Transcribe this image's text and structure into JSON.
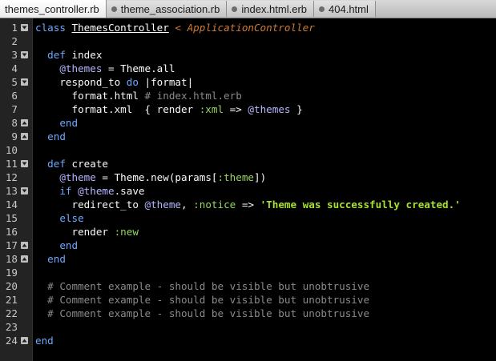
{
  "tabs": [
    {
      "label": "themes_controller.rb",
      "active": true
    },
    {
      "label": "theme_association.rb",
      "active": false
    },
    {
      "label": "index.html.erb",
      "active": false
    },
    {
      "label": "404.html",
      "active": false
    }
  ],
  "lines": [
    {
      "n": "1",
      "fold": "start",
      "tokens": [
        [
          "kw",
          "class "
        ],
        [
          "cls",
          "ThemesController"
        ],
        [
          "inh",
          " < ApplicationController"
        ]
      ]
    },
    {
      "n": "2",
      "fold": "",
      "tokens": []
    },
    {
      "n": "3",
      "fold": "start",
      "tokens": [
        [
          "plain",
          "  "
        ],
        [
          "kw",
          "def "
        ],
        [
          "plain",
          "index"
        ]
      ]
    },
    {
      "n": "4",
      "fold": "",
      "tokens": [
        [
          "plain",
          "    "
        ],
        [
          "ivar",
          "@themes"
        ],
        [
          "plain",
          " = "
        ],
        [
          "const",
          "Theme"
        ],
        [
          "plain",
          ".all"
        ]
      ]
    },
    {
      "n": "5",
      "fold": "start",
      "tokens": [
        [
          "plain",
          "    respond_to "
        ],
        [
          "kw",
          "do"
        ],
        [
          "plain",
          " |format|"
        ]
      ]
    },
    {
      "n": "6",
      "fold": "",
      "tokens": [
        [
          "plain",
          "      format.html "
        ],
        [
          "com",
          "# index.html.erb"
        ]
      ]
    },
    {
      "n": "7",
      "fold": "",
      "tokens": [
        [
          "plain",
          "      format.xml  { render "
        ],
        [
          "sym",
          ":xml"
        ],
        [
          "plain",
          " => "
        ],
        [
          "ivar",
          "@themes"
        ],
        [
          "plain",
          " }"
        ]
      ]
    },
    {
      "n": "8",
      "fold": "end",
      "tokens": [
        [
          "plain",
          "    "
        ],
        [
          "kw",
          "end"
        ]
      ]
    },
    {
      "n": "9",
      "fold": "end",
      "tokens": [
        [
          "plain",
          "  "
        ],
        [
          "kw",
          "end"
        ]
      ]
    },
    {
      "n": "10",
      "fold": "",
      "tokens": []
    },
    {
      "n": "11",
      "fold": "start",
      "tokens": [
        [
          "plain",
          "  "
        ],
        [
          "kw",
          "def "
        ],
        [
          "plain",
          "create"
        ]
      ]
    },
    {
      "n": "12",
      "fold": "",
      "tokens": [
        [
          "plain",
          "    "
        ],
        [
          "ivar",
          "@theme"
        ],
        [
          "plain",
          " = "
        ],
        [
          "const",
          "Theme"
        ],
        [
          "plain",
          ".new(params["
        ],
        [
          "sym",
          ":theme"
        ],
        [
          "plain",
          "])"
        ]
      ]
    },
    {
      "n": "13",
      "fold": "start",
      "tokens": [
        [
          "plain",
          "    "
        ],
        [
          "kw",
          "if "
        ],
        [
          "ivar",
          "@theme"
        ],
        [
          "plain",
          ".save"
        ]
      ]
    },
    {
      "n": "14",
      "fold": "",
      "tokens": [
        [
          "plain",
          "      redirect_to "
        ],
        [
          "ivar",
          "@theme"
        ],
        [
          "plain",
          ", "
        ],
        [
          "sym",
          ":notice"
        ],
        [
          "plain",
          " => "
        ],
        [
          "str",
          "'Theme was successfully created.'"
        ]
      ]
    },
    {
      "n": "15",
      "fold": "",
      "tokens": [
        [
          "plain",
          "    "
        ],
        [
          "kw",
          "else"
        ]
      ]
    },
    {
      "n": "16",
      "fold": "",
      "tokens": [
        [
          "plain",
          "      render "
        ],
        [
          "sym",
          ":new"
        ]
      ]
    },
    {
      "n": "17",
      "fold": "end",
      "tokens": [
        [
          "plain",
          "    "
        ],
        [
          "kw",
          "end"
        ]
      ]
    },
    {
      "n": "18",
      "fold": "end",
      "tokens": [
        [
          "plain",
          "  "
        ],
        [
          "kw",
          "end"
        ]
      ]
    },
    {
      "n": "19",
      "fold": "",
      "tokens": []
    },
    {
      "n": "20",
      "fold": "",
      "tokens": [
        [
          "plain",
          "  "
        ],
        [
          "com",
          "# Comment example - should be visible but unobtrusive"
        ]
      ]
    },
    {
      "n": "21",
      "fold": "",
      "tokens": [
        [
          "plain",
          "  "
        ],
        [
          "com",
          "# Comment example - should be visible but unobtrusive"
        ]
      ]
    },
    {
      "n": "22",
      "fold": "",
      "tokens": [
        [
          "plain",
          "  "
        ],
        [
          "com",
          "# Comment example - should be visible but unobtrusive"
        ]
      ]
    },
    {
      "n": "23",
      "fold": "",
      "tokens": []
    },
    {
      "n": "24",
      "fold": "end",
      "tokens": [
        [
          "kw",
          "end"
        ]
      ]
    }
  ],
  "colors": {
    "background": "#000000",
    "keyword": "#6fa8ff",
    "instance_var": "#b5b5ff",
    "superclass": "#cc7a33",
    "symbol": "#95d65e",
    "string": "#a6e22e",
    "comment": "#8a8a8a"
  },
  "icons": {
    "fold_start": "fold-open-triangle-icon",
    "fold_end": "fold-close-triangle-icon"
  }
}
